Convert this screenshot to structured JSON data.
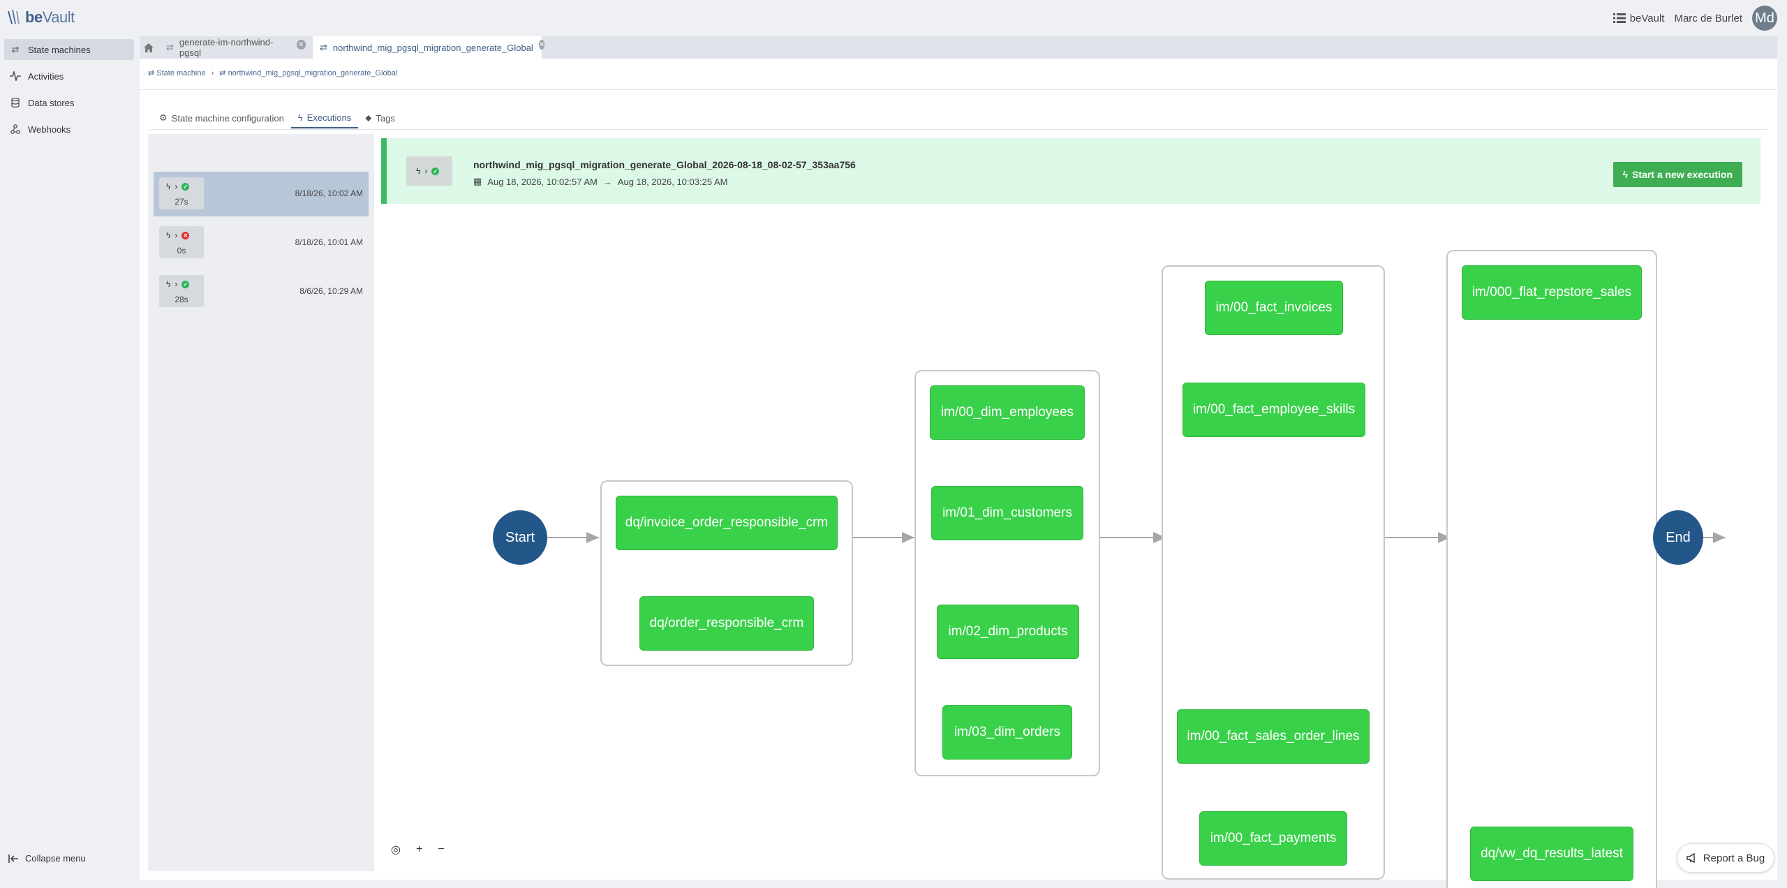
{
  "app": {
    "logo_be": "be",
    "logo_vault": "Vault"
  },
  "header": {
    "menu_label": "beVault",
    "user_name": "Marc de Burlet",
    "avatar_initials": "Md"
  },
  "sidebar": {
    "items": [
      {
        "label": "State machines",
        "icon": "state-machine-icon",
        "active": true
      },
      {
        "label": "Activities",
        "icon": "activity-icon",
        "active": false
      },
      {
        "label": "Data stores",
        "icon": "database-icon",
        "active": false
      },
      {
        "label": "Webhooks",
        "icon": "webhook-icon",
        "active": false
      }
    ],
    "collapse_label": "Collapse menu"
  },
  "tabs": [
    {
      "label": "generate-im-northwind-pgsql",
      "active": false
    },
    {
      "label": "northwind_mig_pgsql_migration_generate_Global",
      "active": true
    }
  ],
  "breadcrumb": {
    "root": "State machine",
    "current": "northwind_mig_pgsql_migration_generate_Global"
  },
  "subtabs": [
    {
      "label": "State machine configuration",
      "icon": "gear-icon"
    },
    {
      "label": "Executions",
      "icon": "bolt-icon",
      "active": true
    },
    {
      "label": "Tags",
      "icon": "tag-icon"
    }
  ],
  "executions": [
    {
      "duration": "27s",
      "date": "8/18/26, 10:02 AM",
      "status": "success",
      "active": true
    },
    {
      "duration": "0s",
      "date": "8/18/26, 10:01 AM",
      "status": "failed",
      "active": false
    },
    {
      "duration": "28s",
      "date": "8/6/26, 10:29 AM",
      "status": "success",
      "active": false
    }
  ],
  "execution_detail": {
    "title": "northwind_mig_pgsql_migration_generate_Global_2026-08-18_08-02-57_353aa756",
    "start": "Aug 18, 2026, 10:02:57 AM",
    "end": "Aug 18, 2026, 10:03:25 AM",
    "status": "success",
    "new_execution_label": "Start a new execution"
  },
  "diagram": {
    "start_label": "Start",
    "end_label": "End",
    "stage1": [
      "dq/invoice_order_responsible_crm",
      "dq/order_responsible_crm"
    ],
    "stage2": [
      "im/00_dim_employees",
      "im/01_dim_customers",
      "im/02_dim_products",
      "im/03_dim_orders"
    ],
    "stage3": [
      "im/00_fact_invoices",
      "im/00_fact_employee_skills",
      "im/00_fact_sales_order_lines",
      "im/00_fact_payments"
    ],
    "stage4": [
      "im/000_flat_repstore_sales",
      "dq/vw_dq_results_latest"
    ],
    "node_color": "#3ad14a",
    "circle_color": "#245789"
  },
  "zoom_controls": {
    "fit": "◎",
    "zoom_in": "+",
    "zoom_out": "−"
  },
  "report_bug": {
    "label": "Report a Bug"
  },
  "colors": {
    "accent": "#3f5f86",
    "success": "#3cba65",
    "error": "#e0312f"
  }
}
